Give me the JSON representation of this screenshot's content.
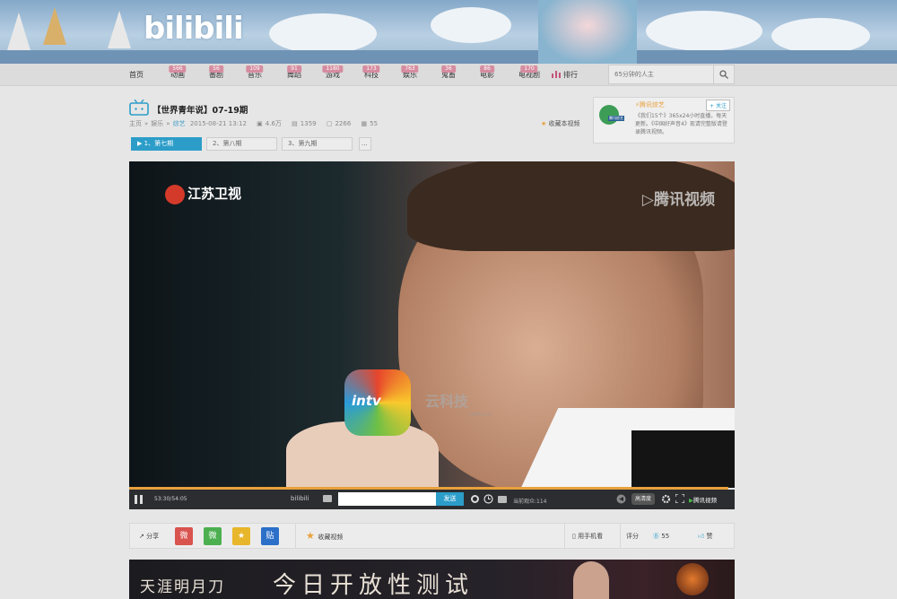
{
  "site": {
    "logo_text": "bilibili"
  },
  "nav": {
    "items": [
      {
        "label": "首页",
        "badge": ""
      },
      {
        "label": "动画",
        "badge": "566"
      },
      {
        "label": "番剧",
        "badge": "56"
      },
      {
        "label": "音乐",
        "badge": "109"
      },
      {
        "label": "舞蹈",
        "badge": "91"
      },
      {
        "label": "游戏",
        "badge": "1180"
      },
      {
        "label": "科技",
        "badge": "173"
      },
      {
        "label": "娱乐",
        "badge": "763"
      },
      {
        "label": "鬼畜",
        "badge": "36"
      },
      {
        "label": "电影",
        "badge": "86"
      },
      {
        "label": "电视剧",
        "badge": "170"
      },
      {
        "label": "排行",
        "badge": ""
      }
    ],
    "search_placeholder": "65分钟的人主"
  },
  "video": {
    "title": "【世界青年说】07-19期",
    "breadcrumb": [
      "主页",
      "»",
      "娱乐",
      "»",
      "综艺"
    ],
    "date": "2015-08-21 13:12",
    "plays": "4.6万",
    "danmaku": "1359",
    "favorites": "2266",
    "coins": "55",
    "favorite_label": "收藏本视频"
  },
  "episodes": [
    {
      "label": "1、第七期",
      "active": true
    },
    {
      "label": "2、第八期",
      "active": false
    },
    {
      "label": "3、第九期",
      "active": false
    },
    {
      "label": "...",
      "active": false
    }
  ],
  "uploader_box": {
    "name": "腾讯综艺",
    "follow_label": "+ 关注",
    "description": "《我们15个》365x24小时直播，每天更新。《中国好声音4》现请完整版请登录腾讯视频。",
    "logo_text": "腾讯综艺"
  },
  "player": {
    "channel_logo": "江苏卫视",
    "watermark": "腾讯视频",
    "intv_logo": "intv",
    "intv_text": "云科技",
    "intv_sub": "com.cn",
    "time": "53:30/54:05",
    "brand": "bilibili",
    "send_label": "发送",
    "viewers": "当前观众:114",
    "quality_label": "高清度",
    "tencent_label": "腾讯视频",
    "progress_fraction": 0.99
  },
  "share_bar": {
    "share_label": "分享",
    "weibo": "微",
    "wechat": "微",
    "qzone": "★",
    "tieba": "贴",
    "collect_label": "收藏视频",
    "mobile_label": "用手机看",
    "rating_label": "评分",
    "coin_count": "55",
    "like_label": "赞"
  },
  "bottom_ad": {
    "text_left": "天涯明月刀",
    "text_main": "今日开放性测试"
  },
  "colors": {
    "accent": "#2c9dc9",
    "badge": "#d68ca0",
    "progress": "#e8a13c"
  }
}
